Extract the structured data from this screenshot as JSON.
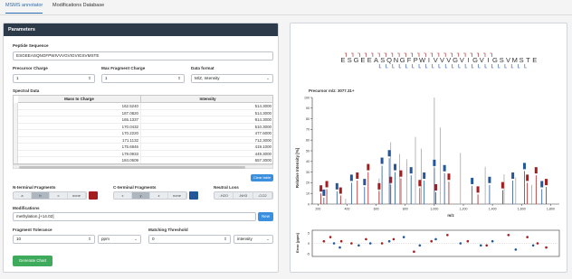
{
  "tabs": [
    "MSMS annotator",
    "Modifications Database"
  ],
  "panel_title": "Parameters",
  "peptide_label": "Peptide Sequence",
  "peptide_value": "ESGEEASQNGFPWIVVVGVIGVIGSVMSTE",
  "precursor_charge_label": "Precursor Charge",
  "precursor_charge_value": "1",
  "max_fragment_charge_label": "Max Fragment Charge",
  "max_fragment_charge_value": "1",
  "data_format_label": "Data format",
  "data_format_value": "M/Z, Intensity",
  "spectral_data_label": "Spectral Data",
  "table": {
    "headers": [
      "Mass to Charge",
      "Intensity"
    ],
    "rows": [
      [
        "162.5240",
        "514.3000"
      ],
      [
        "187.0820",
        "514.3000"
      ],
      [
        "165.1337",
        "814.3000"
      ],
      [
        "170.0432",
        "510.3000"
      ],
      [
        "170.2220",
        "477.6000"
      ],
      [
        "171.1132",
        "712.3000"
      ],
      [
        "175.6846",
        "419.1000"
      ],
      [
        "179.0933",
        "449.3000"
      ],
      [
        "184.0609",
        "657.3000"
      ],
      [
        "185.1288",
        "..."
      ]
    ]
  },
  "clear_table": "Clear table",
  "nterm_label": "N-terminal Fragments",
  "nterm_options": [
    "a",
    "b",
    "c",
    "none"
  ],
  "nterm_color": "#a41d1f",
  "cterm_label": "C-terminal Fragments",
  "cterm_options": [
    "x",
    "y",
    "z",
    "none"
  ],
  "cterm_color": "#23579a",
  "neutral_label": "Neutral Loss",
  "neutral_options": [
    "-H2O",
    "-NH3",
    "-CO2"
  ],
  "modifications_label": "Modifications",
  "modifications_value": "methylation,[+14.02]",
  "new_btn": "New",
  "frag_tol_label": "Fragment Tolerance",
  "frag_tol_value": "10",
  "frag_tol_unit": "ppm",
  "match_label": "Matching Threshold",
  "match_value": "0",
  "match_unit": "intensity",
  "generate_btn": "Generate Chart",
  "colors": {
    "accent": "#2b6cb0",
    "green": "#3daa5c",
    "header": "#2d3a4a",
    "button_blue": "#3a90df"
  },
  "chart_data": [
    {
      "type": "bar",
      "title": "Precursor m/z: 3077.31+",
      "ylabel": "Relative Intensity [%]",
      "xlabel": "m/z",
      "x_ticks": [
        "200",
        "400",
        "600",
        "800",
        "1,000",
        "1,200",
        "1,400",
        "1,600",
        "1,800"
      ],
      "y_ticks": [
        "0",
        "10",
        "20",
        "30",
        "40",
        "50",
        "60",
        "70",
        "80",
        "90",
        "100"
      ],
      "sequence": "ESGEEASQNGFPWIVVVGVIGVIGSVMSTE",
      "peaks_red": [
        [
          220,
          10
        ],
        [
          260,
          14
        ],
        [
          355,
          8
        ],
        [
          470,
          22
        ],
        [
          545,
          30
        ],
        [
          620,
          12
        ],
        [
          700,
          18
        ],
        [
          770,
          24
        ],
        [
          900,
          15
        ],
        [
          1010,
          11
        ],
        [
          1100,
          21
        ],
        [
          1300,
          9
        ],
        [
          1470,
          13
        ],
        [
          1640,
          20
        ],
        [
          1700,
          27
        ],
        [
          1770,
          16
        ]
      ],
      "peaks_blue": [
        [
          240,
          6
        ],
        [
          330,
          12
        ],
        [
          430,
          20
        ],
        [
          520,
          16
        ],
        [
          640,
          36
        ],
        [
          690,
          43
        ],
        [
          730,
          30
        ],
        [
          840,
          27
        ],
        [
          930,
          22
        ],
        [
          1000,
          34
        ],
        [
          1070,
          29
        ],
        [
          1260,
          17
        ],
        [
          1380,
          18
        ],
        [
          1540,
          22
        ],
        [
          1620,
          31
        ],
        [
          1740,
          14
        ]
      ],
      "peaks_grey": [
        [
          390,
          5
        ],
        [
          620,
          24
        ],
        [
          700,
          58
        ],
        [
          760,
          47
        ],
        [
          810,
          42
        ],
        [
          870,
          63
        ],
        [
          910,
          52
        ],
        [
          1000,
          100
        ],
        [
          1040,
          72
        ],
        [
          1180,
          48
        ],
        [
          1350,
          35
        ],
        [
          1480,
          28
        ],
        [
          1560,
          25
        ],
        [
          1670,
          18
        ]
      ]
    },
    {
      "type": "scatter",
      "ylabel": "Error [ppm]",
      "y_ticks": [
        "5",
        "0",
        "-5"
      ],
      "points_red": [
        [
          240,
          1
        ],
        [
          285,
          3
        ],
        [
          360,
          1
        ],
        [
          430,
          0
        ],
        [
          530,
          2
        ],
        [
          640,
          0
        ],
        [
          720,
          2
        ],
        [
          860,
          -4
        ],
        [
          980,
          1
        ],
        [
          1090,
          4
        ],
        [
          1230,
          1
        ],
        [
          1360,
          -1
        ],
        [
          1510,
          4
        ],
        [
          1640,
          3
        ],
        [
          1710,
          0
        ],
        [
          1770,
          -2
        ]
      ],
      "points_blue": [
        [
          310,
          0
        ],
        [
          350,
          -2
        ],
        [
          480,
          -1
        ],
        [
          560,
          0
        ],
        [
          690,
          1
        ],
        [
          790,
          3
        ],
        [
          900,
          -1
        ],
        [
          1010,
          2
        ],
        [
          1180,
          0
        ],
        [
          1320,
          -1
        ],
        [
          1400,
          1
        ],
        [
          1560,
          -3
        ],
        [
          1680,
          -1
        ]
      ]
    }
  ]
}
